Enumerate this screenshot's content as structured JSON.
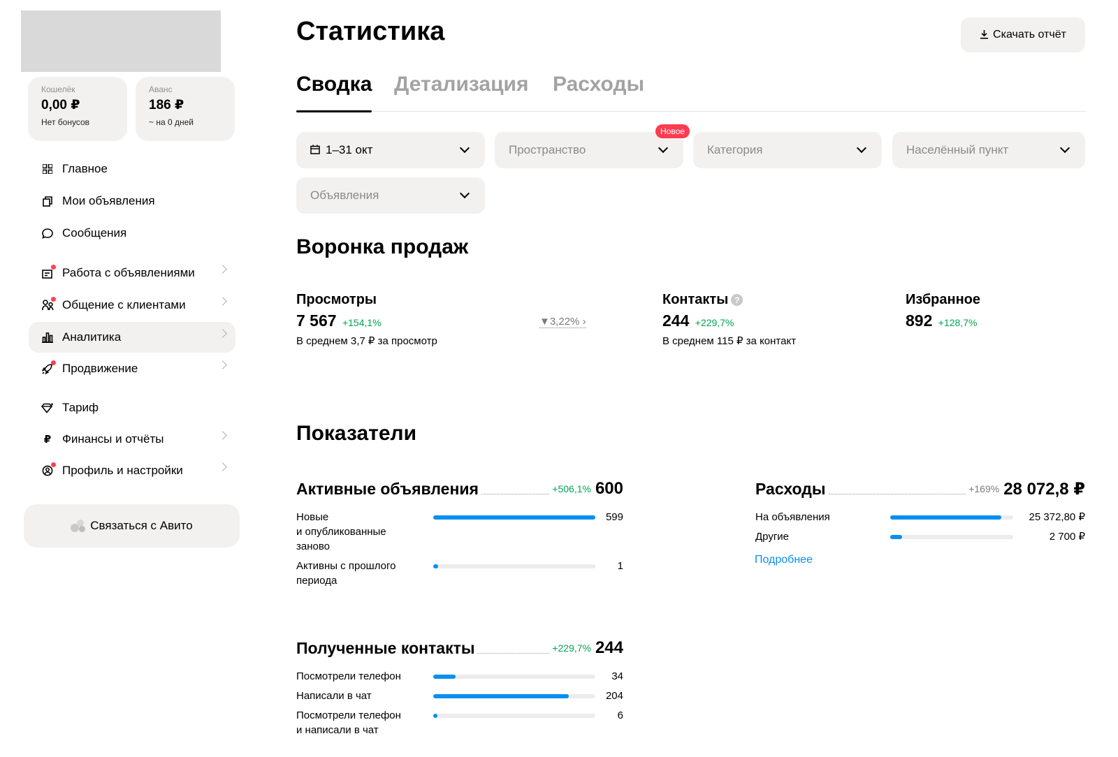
{
  "sidebar": {
    "wallet": {
      "label": "Кошелёк",
      "value": "0,00 ₽",
      "sub": "Нет бонусов"
    },
    "advance": {
      "label": "Аванс",
      "value": "186 ₽",
      "sub": "~ на 0 дней"
    },
    "items": [
      {
        "label": "Главное",
        "icon": "grid-icon"
      },
      {
        "label": "Мои объявления",
        "icon": "copy-icon"
      },
      {
        "label": "Сообщения",
        "icon": "chat-icon"
      },
      {
        "label": "Работа с объявлениями",
        "icon": "ad-work-icon"
      },
      {
        "label": "Общение с клиентами",
        "icon": "clients-icon"
      },
      {
        "label": "Аналитика",
        "icon": "bar-chart-icon"
      },
      {
        "label": "Продвижение",
        "icon": "rocket-icon"
      },
      {
        "label": "Тариф",
        "icon": "diamond-icon"
      },
      {
        "label": "Финансы и отчёты",
        "icon": "ruble-icon"
      },
      {
        "label": "Профиль и настройки",
        "icon": "profile-settings-icon"
      }
    ],
    "contact_button": "Связаться с Авито"
  },
  "header": {
    "title": "Статистика",
    "download_label": "Скачать отчёт"
  },
  "tabs": [
    "Сводка",
    "Детализация",
    "Расходы"
  ],
  "filters": {
    "period": "1–31 окт",
    "space": "Пространство",
    "new_badge": "Новое",
    "category": "Категория",
    "locality": "Населённый пункт",
    "ads": "Объявления"
  },
  "funnel": {
    "title": "Воронка продаж",
    "views": {
      "title": "Просмотры",
      "value": "7 567",
      "change": "+154,1%",
      "sub": "В среднем 3,7 ₽ за просмотр"
    },
    "conversion": "3,22%",
    "contacts": {
      "title": "Контакты",
      "value": "244",
      "change": "+229,7%",
      "sub": "В среднем 115 ₽ за контакт"
    },
    "favorites": {
      "title": "Избранное",
      "value": "892",
      "change": "+128,7%"
    }
  },
  "indicators": {
    "title": "Показатели",
    "active_ads": {
      "title": "Активные объявления",
      "change": "+506,1%",
      "total": "600",
      "rows": [
        {
          "label": "Новые\nи опубликованные\nзаново",
          "value": "599",
          "fraction": 0.998
        },
        {
          "label": "Активны с прошлого\nпериода",
          "value": "1",
          "fraction": 0.03
        }
      ]
    },
    "expenses": {
      "title": "Расходы",
      "change": "+169%",
      "total": "28 072,8 ₽",
      "rows": [
        {
          "label": "На объявления",
          "value": "25 372,80 ₽",
          "fraction": 0.904
        },
        {
          "label": "Другие",
          "value": "2 700 ₽",
          "fraction": 0.096
        }
      ],
      "more_link": "Подробнее"
    },
    "contacts": {
      "title": "Полученные контакты",
      "change": "+229,7%",
      "total": "244",
      "rows": [
        {
          "label": "Посмотрели телефон",
          "value": "34",
          "fraction": 0.139
        },
        {
          "label": "Написали в чат",
          "value": "204",
          "fraction": 0.836
        },
        {
          "label": "Посмотрели телефон\nи написали в чат",
          "value": "6",
          "fraction": 0.025
        }
      ]
    }
  },
  "colors": {
    "accent": "#0a8ff0",
    "positive": "#00a651",
    "badge": "#ff3b4f",
    "surface": "#f2f1f0"
  }
}
